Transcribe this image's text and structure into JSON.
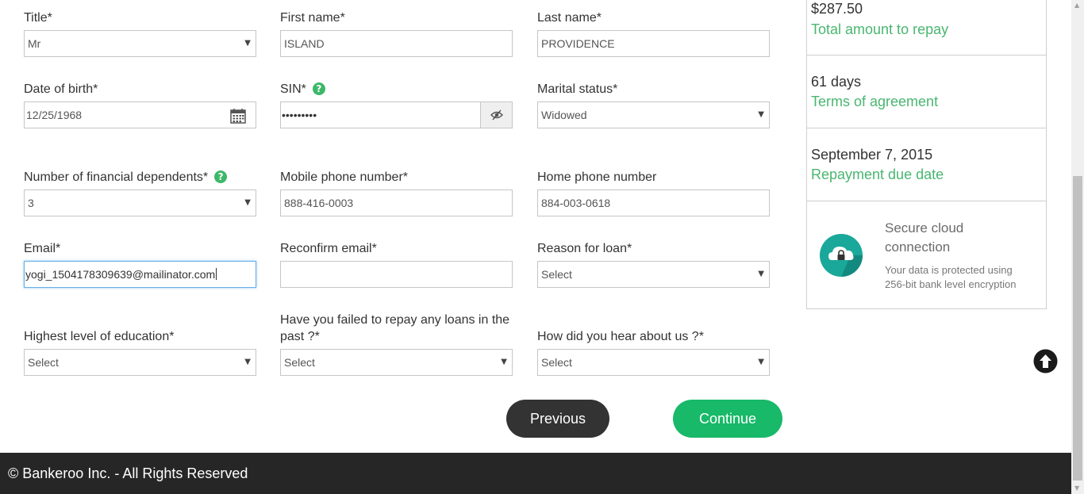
{
  "form": {
    "title": {
      "label": "Title*",
      "value": "Mr"
    },
    "first_name": {
      "label": "First name*",
      "value": "ISLAND"
    },
    "last_name": {
      "label": "Last name*",
      "value": "PROVIDENCE"
    },
    "dob": {
      "label": "Date of birth*",
      "value": "12/25/1968"
    },
    "sin": {
      "label": "SIN*",
      "value": "•••••••••"
    },
    "marital": {
      "label": "Marital status*",
      "value": "Widowed"
    },
    "dependents": {
      "label": "Number of financial dependents*",
      "value": "3"
    },
    "mobile": {
      "label": "Mobile phone number*",
      "value": "888-416-0003"
    },
    "home_phone": {
      "label": "Home phone number",
      "value": "884-003-0618"
    },
    "email": {
      "label": "Email*",
      "value": "yogi_1504178309639@mailinator.com"
    },
    "reconfirm_email": {
      "label": "Reconfirm email*",
      "value": ""
    },
    "reason": {
      "label": "Reason for loan*",
      "value": "Select"
    },
    "education": {
      "label": "Highest level of education*",
      "value": "Select"
    },
    "failed_repay": {
      "label": "Have you failed to repay any loans in the past ?*",
      "value": "Select"
    },
    "hear_about": {
      "label": "How did you hear about us ?*",
      "value": "Select"
    },
    "help_glyph": "?",
    "caret_glyph": "▼"
  },
  "buttons": {
    "previous": "Previous",
    "continue": "Continue"
  },
  "summary": {
    "total": {
      "value": "$287.50",
      "label": "Total amount to repay"
    },
    "terms": {
      "value": "61 days",
      "label": "Terms of agreement"
    },
    "due": {
      "value": "September 7, 2015",
      "label": "Repayment due date"
    },
    "secure": {
      "title": "Secure cloud connection",
      "desc": "Your data is protected using 256-bit bank level encryption"
    }
  },
  "footer": {
    "text": "© Bankeroo Inc. - All Rights Reserved"
  },
  "colors": {
    "accent_green": "#49b670",
    "continue_button": "#18b968",
    "footer_bg": "#262626"
  }
}
